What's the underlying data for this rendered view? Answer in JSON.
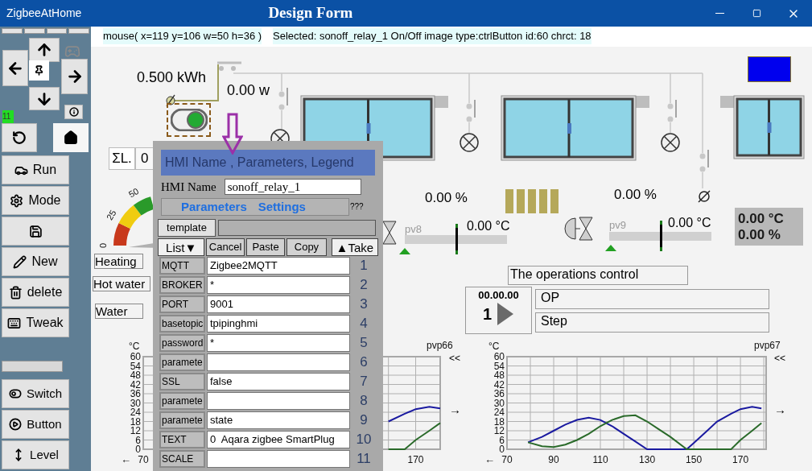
{
  "window": {
    "app_name": "ZigbeeAtHome",
    "title": "Design Form"
  },
  "sidebar": {
    "badge": "11",
    "buttons": [
      {
        "kind": "text",
        "label": "Run"
      },
      {
        "kind": "text",
        "label": "Mode"
      },
      {
        "kind": "icon"
      },
      {
        "kind": "text",
        "label": "New"
      },
      {
        "kind": "text",
        "label": "delete"
      },
      {
        "kind": "text",
        "label": "Tweak"
      }
    ],
    "tools": [
      {
        "label": "Switch"
      },
      {
        "label": "Button"
      },
      {
        "label": "Level"
      }
    ]
  },
  "status": {
    "mouse": "mouse( x=119 y=106 w=50 h=36 )",
    "selected": "Selected: sonoff_relay_1 On/Off image type:ctrlButton id:60 chrct: 18"
  },
  "canvas": {
    "energy": "0.500 kWh",
    "power": "0.00 w",
    "relay_switch": {
      "on": true
    },
    "sum_label": "ΣL.",
    "sum_value": "0",
    "gauge_ticks": [
      "0",
      "25",
      "50"
    ],
    "zone_labels": [
      "Heating",
      "Hot water",
      "Water"
    ],
    "percent_readings": [
      "0.00 %",
      "0.00 %"
    ],
    "sliders": [
      {
        "name": "pv8",
        "reading": "0.00 °C",
        "level": 0.5
      },
      {
        "name": "pv9",
        "reading": "0.00 °C",
        "level": 0.5
      }
    ],
    "readout": [
      "0.00 °C",
      "0.00 %"
    ],
    "operations": {
      "title": "The operations control",
      "timer": "00.00.00",
      "step_number": "1",
      "op": "OP",
      "step": "Step"
    },
    "charts": [
      {
        "back_arrow": "←",
        "nav_back": "<<",
        "nav_next": "→",
        "chart_data": {
          "type": "line",
          "title": "pvp66",
          "ylabel": "°C",
          "grid": true,
          "x": [
            160,
            166,
            170,
            175,
            179
          ],
          "series": [
            {
              "color": "#1a1aa0",
              "values": [
                18,
                23,
                26,
                27.5,
                26.5
              ]
            },
            {
              "color": "#2a6a2a",
              "values": [
                0,
                0,
                6,
                12,
                17
              ]
            }
          ],
          "xlim": [
            70,
            179
          ],
          "ylim": [
            0,
            60
          ],
          "xticks": [
            70,
            170
          ],
          "yticks": [
            0,
            6,
            12,
            18,
            24,
            30,
            36,
            42,
            48,
            54,
            60
          ]
        }
      },
      {
        "back_arrow": "←",
        "nav_back": "<<",
        "nav_next": "→",
        "chart_data": {
          "type": "line",
          "title": "pvp67",
          "grid": true,
          "ylabel": "°C",
          "x": [
            79,
            85,
            90,
            95,
            100,
            105,
            110,
            115,
            120,
            125,
            130,
            135,
            140,
            147,
            150,
            155,
            160,
            166,
            170,
            175,
            179
          ],
          "series": [
            {
              "color": "#1a1aa0",
              "values": [
                4.5,
                8,
                12,
                16,
                19,
                20.5,
                19,
                15,
                10,
                5,
                0,
                0,
                0,
                0,
                4,
                11,
                18,
                23,
                26,
                27.5,
                26.5
              ]
            },
            {
              "color": "#2a6a2a",
              "values": [
                4.5,
                2,
                1.5,
                3,
                6,
                10,
                15,
                19,
                21.5,
                22,
                18,
                13,
                8,
                0,
                0,
                0,
                0,
                0,
                6,
                12,
                17
              ]
            }
          ],
          "xlim": [
            70,
            181
          ],
          "ylim": [
            0,
            60
          ],
          "xticks": [
            70,
            90,
            110,
            130,
            150,
            170
          ],
          "yticks": [
            0,
            6,
            12,
            18,
            24,
            30,
            36,
            42,
            48,
            54,
            60
          ]
        }
      }
    ]
  },
  "dialog": {
    "title": "HMI Name , Parameters, Legend",
    "name_label": "HMI Name",
    "name_value": "sonoff_relay_1",
    "tabs": [
      "Parameters",
      "Settings"
    ],
    "hint": "???",
    "template_button": "template",
    "buttons": [
      "List▼",
      "Cancel",
      "Paste",
      "Copy",
      "▲Take"
    ],
    "rows": [
      {
        "label": "MQTT",
        "value": "Zigbee2MQTT",
        "number": "1"
      },
      {
        "label": "BROKER",
        "value": "*",
        "number": "2"
      },
      {
        "label": "PORT",
        "value": "9001",
        "number": "3"
      },
      {
        "label": "basetopic",
        "value": "tpipinghmi",
        "number": "4"
      },
      {
        "label": "password",
        "value": "*",
        "number": "5"
      },
      {
        "label": "paramete",
        "number": "6"
      },
      {
        "label": "SSL",
        "value": "false",
        "number": "7"
      },
      {
        "label": "paramete",
        "number": "8"
      },
      {
        "label": "paramete",
        "value": "state",
        "number": "9"
      },
      {
        "label": "TEXT",
        "value": "0  Aqara zigbee SmartPlug",
        "number": "10"
      },
      {
        "label": "SCALE",
        "number": "11"
      }
    ]
  }
}
